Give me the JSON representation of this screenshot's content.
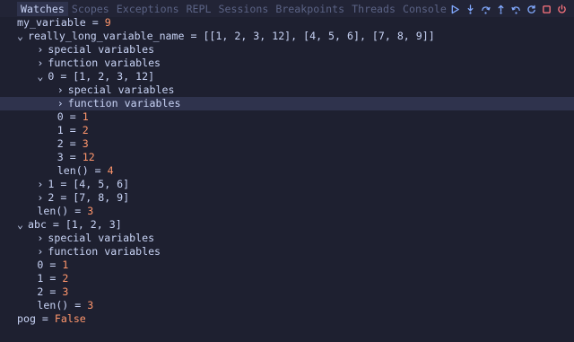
{
  "tabs": [
    {
      "label": "Watches",
      "active": true
    },
    {
      "label": "Scopes",
      "active": false
    },
    {
      "label": "Exceptions",
      "active": false
    },
    {
      "label": "REPL",
      "active": false
    },
    {
      "label": "Sessions",
      "active": false
    },
    {
      "label": "Breakpoints",
      "active": false
    },
    {
      "label": "Threads",
      "active": false
    },
    {
      "label": "Console",
      "active": false
    }
  ],
  "controls": [
    {
      "icon": "play-icon"
    },
    {
      "icon": "step-into-icon"
    },
    {
      "icon": "step-over-icon"
    },
    {
      "icon": "step-out-icon"
    },
    {
      "icon": "step-back-icon"
    },
    {
      "icon": "restart-icon"
    },
    {
      "icon": "stop-icon"
    },
    {
      "icon": "disconnect-icon"
    }
  ],
  "colors": {
    "background": "#1e2030",
    "foreground": "#c8d3f5",
    "number": "#ff966c",
    "selection": "#2f334d",
    "tab_inactive": "#5b6385",
    "play": "#82aaff",
    "stop": "#ff757f"
  },
  "tree": [
    {
      "indent": 0,
      "chevron": "",
      "parts": [
        {
          "t": "my_variable = ",
          "c": "txt"
        },
        {
          "t": "9",
          "c": "num"
        }
      ]
    },
    {
      "indent": 0,
      "chevron": "⌄",
      "parts": [
        {
          "t": "really_long_variable_name = [[1, 2, 3, 12], [4, 5, 6], [7, 8, 9]]",
          "c": "txt"
        }
      ]
    },
    {
      "indent": 2,
      "chevron": "›",
      "parts": [
        {
          "t": "special variables",
          "c": "txt"
        }
      ]
    },
    {
      "indent": 2,
      "chevron": "›",
      "parts": [
        {
          "t": "function variables",
          "c": "txt"
        }
      ]
    },
    {
      "indent": 2,
      "chevron": "⌄",
      "parts": [
        {
          "t": "0 = [1, 2, 3, 12]",
          "c": "txt"
        }
      ]
    },
    {
      "indent": 4,
      "chevron": "›",
      "parts": [
        {
          "t": "special variables",
          "c": "txt"
        }
      ]
    },
    {
      "indent": 4,
      "chevron": "›",
      "parts": [
        {
          "t": "function variables",
          "c": "txt"
        }
      ],
      "selected": true
    },
    {
      "indent": 4,
      "chevron": "",
      "parts": [
        {
          "t": "0 = ",
          "c": "txt"
        },
        {
          "t": "1",
          "c": "num"
        }
      ]
    },
    {
      "indent": 4,
      "chevron": "",
      "parts": [
        {
          "t": "1 = ",
          "c": "txt"
        },
        {
          "t": "2",
          "c": "num"
        }
      ]
    },
    {
      "indent": 4,
      "chevron": "",
      "parts": [
        {
          "t": "2 = ",
          "c": "txt"
        },
        {
          "t": "3",
          "c": "num"
        }
      ]
    },
    {
      "indent": 4,
      "chevron": "",
      "parts": [
        {
          "t": "3 = ",
          "c": "txt"
        },
        {
          "t": "12",
          "c": "num"
        }
      ]
    },
    {
      "indent": 4,
      "chevron": "",
      "parts": [
        {
          "t": "len() = ",
          "c": "txt"
        },
        {
          "t": "4",
          "c": "num"
        }
      ]
    },
    {
      "indent": 2,
      "chevron": "›",
      "parts": [
        {
          "t": "1 = [4, 5, 6]",
          "c": "txt"
        }
      ]
    },
    {
      "indent": 2,
      "chevron": "›",
      "parts": [
        {
          "t": "2 = [7, 8, 9]",
          "c": "txt"
        }
      ]
    },
    {
      "indent": 2,
      "chevron": "",
      "parts": [
        {
          "t": "len() = ",
          "c": "txt"
        },
        {
          "t": "3",
          "c": "num"
        }
      ]
    },
    {
      "indent": 0,
      "chevron": "⌄",
      "parts": [
        {
          "t": "abc = [1, 2, 3]",
          "c": "txt"
        }
      ]
    },
    {
      "indent": 2,
      "chevron": "›",
      "parts": [
        {
          "t": "special variables",
          "c": "txt"
        }
      ]
    },
    {
      "indent": 2,
      "chevron": "›",
      "parts": [
        {
          "t": "function variables",
          "c": "txt"
        }
      ]
    },
    {
      "indent": 2,
      "chevron": "",
      "parts": [
        {
          "t": "0 = ",
          "c": "txt"
        },
        {
          "t": "1",
          "c": "num"
        }
      ]
    },
    {
      "indent": 2,
      "chevron": "",
      "parts": [
        {
          "t": "1 = ",
          "c": "txt"
        },
        {
          "t": "2",
          "c": "num"
        }
      ]
    },
    {
      "indent": 2,
      "chevron": "",
      "parts": [
        {
          "t": "2 = ",
          "c": "txt"
        },
        {
          "t": "3",
          "c": "num"
        }
      ]
    },
    {
      "indent": 2,
      "chevron": "",
      "parts": [
        {
          "t": "len() = ",
          "c": "txt"
        },
        {
          "t": "3",
          "c": "num"
        }
      ]
    },
    {
      "indent": 0,
      "chevron": "",
      "parts": [
        {
          "t": "pog = ",
          "c": "txt"
        },
        {
          "t": "False",
          "c": "kw"
        }
      ]
    }
  ]
}
